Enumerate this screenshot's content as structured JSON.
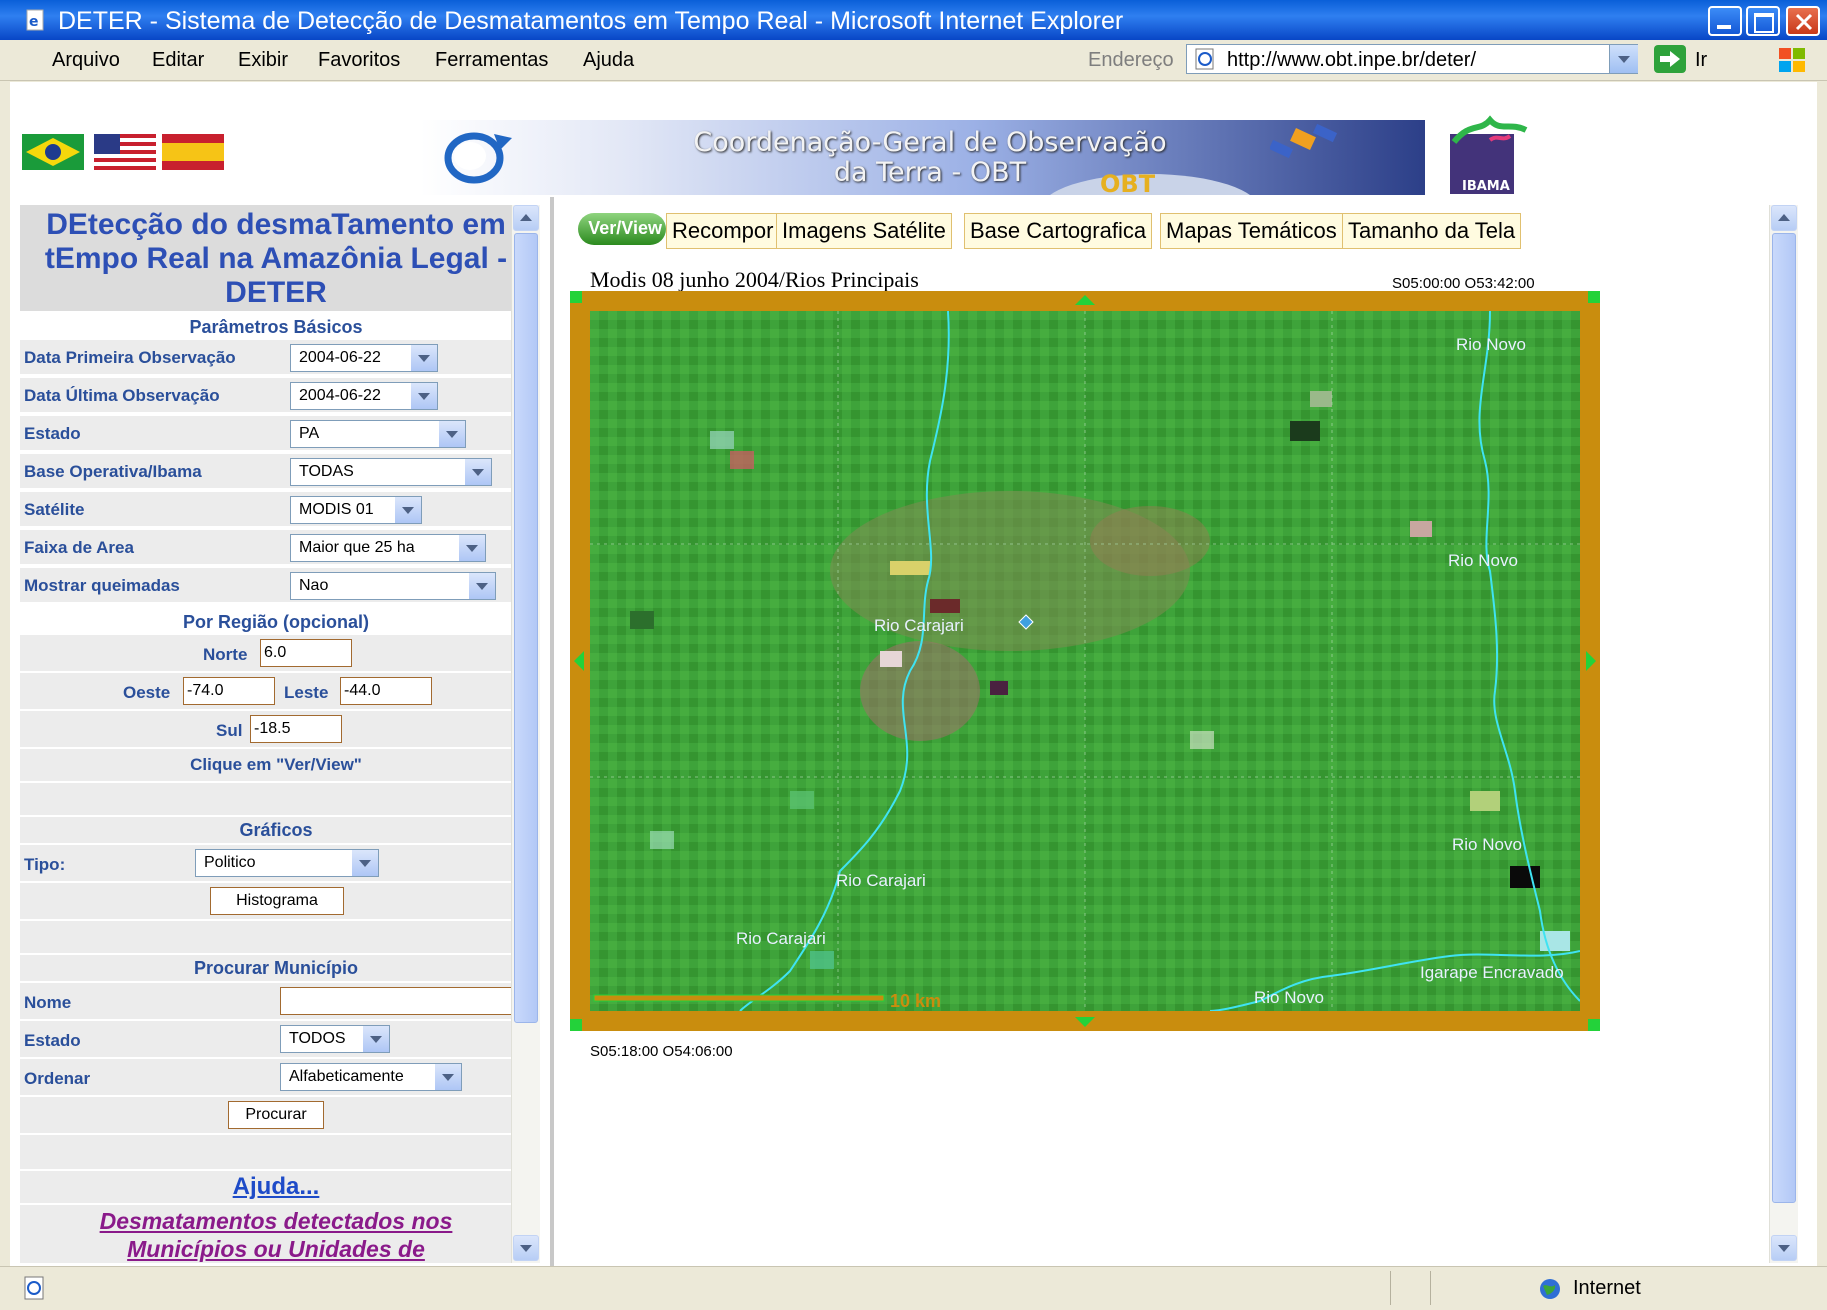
{
  "window": {
    "title": "DETER - Sistema de Detecção de Desmatamentos em Tempo Real - Microsoft Internet Explorer"
  },
  "menu": [
    "Arquivo",
    "Editar",
    "Exibir",
    "Favoritos",
    "Ferramentas",
    "Ajuda"
  ],
  "address": {
    "label": "Endereço",
    "url": "http://www.obt.inpe.br/deter/",
    "go_label": "Ir"
  },
  "banner": {
    "title_line1": "Coordenação-Geral de Observação",
    "title_line2": "da Terra - OBT",
    "obt_text": "OBT",
    "ibama_text": "IBAMA"
  },
  "left": {
    "title": "DEtecção do desmaTamento em tEmpo Real na Amazônia Legal - DETER",
    "basic_params_header": "Parâmetros Básicos",
    "fields": [
      {
        "label": "Data Primeira Observação",
        "value": "2004-06-22"
      },
      {
        "label": "Data Última Observação",
        "value": "2004-06-22"
      },
      {
        "label": "Estado",
        "value": "PA"
      },
      {
        "label": "Base Operativa/Ibama",
        "value": "TODAS"
      },
      {
        "label": "Satélite",
        "value": "MODIS 01"
      },
      {
        "label": "Faixa de Area",
        "value": "Maior que 25 ha"
      },
      {
        "label": "Mostrar queimadas",
        "value": "Nao"
      }
    ],
    "region": {
      "header": "Por Região (opcional)",
      "norte_label": "Norte",
      "norte_value": "6.0",
      "oeste_label": "Oeste",
      "oeste_value": "-74.0",
      "leste_label": "Leste",
      "leste_value": "-44.0",
      "sul_label": "Sul",
      "sul_value": "-18.5",
      "hint": "Clique em \"Ver/View\""
    },
    "graficos": {
      "header": "Gráficos",
      "tipo_label": "Tipo:",
      "tipo_value": "Politico",
      "button": "Histograma"
    },
    "municipio": {
      "header": "Procurar Município",
      "nome_label": "Nome",
      "nome_value": "",
      "estado_label": "Estado",
      "estado_value": "TODOS",
      "ordenar_label": "Ordenar",
      "ordenar_value": "Alfabeticamente",
      "button": "Procurar"
    },
    "ajuda_link": "Ajuda...",
    "desmat_link_line1": "Desmatamentos detectados nos",
    "desmat_link_line2": "Municípios ou Unidades de"
  },
  "right": {
    "tabs": [
      "Ver/View",
      "Recompor",
      "Imagens Satélite",
      "Base Cartografica",
      "Mapas Temáticos",
      "Tamanho da Tela"
    ],
    "caption": "Modis 08 junho 2004/Rios Principais",
    "coord_top_right": "S05:00:00 O53:42:00",
    "coord_bottom_left": "S05:18:00 O54:06:00",
    "scale_text": "10 km",
    "river_labels": [
      "Rio Novo",
      "Rio Novo",
      "Rio Carajari",
      "Rio Carajari",
      "Rio Carajari",
      "Rio Novo",
      "Igarape Encravado",
      "Rio Novo"
    ]
  },
  "status": {
    "zone": "Internet"
  },
  "colors": {
    "title_bar": "#0a5fd8",
    "map_frame": "#c98d0e",
    "map_green": "#3ea33a",
    "river": "#3fe3f2",
    "label_blue": "#2a4f9a",
    "link_purple": "#8a1a8a"
  }
}
